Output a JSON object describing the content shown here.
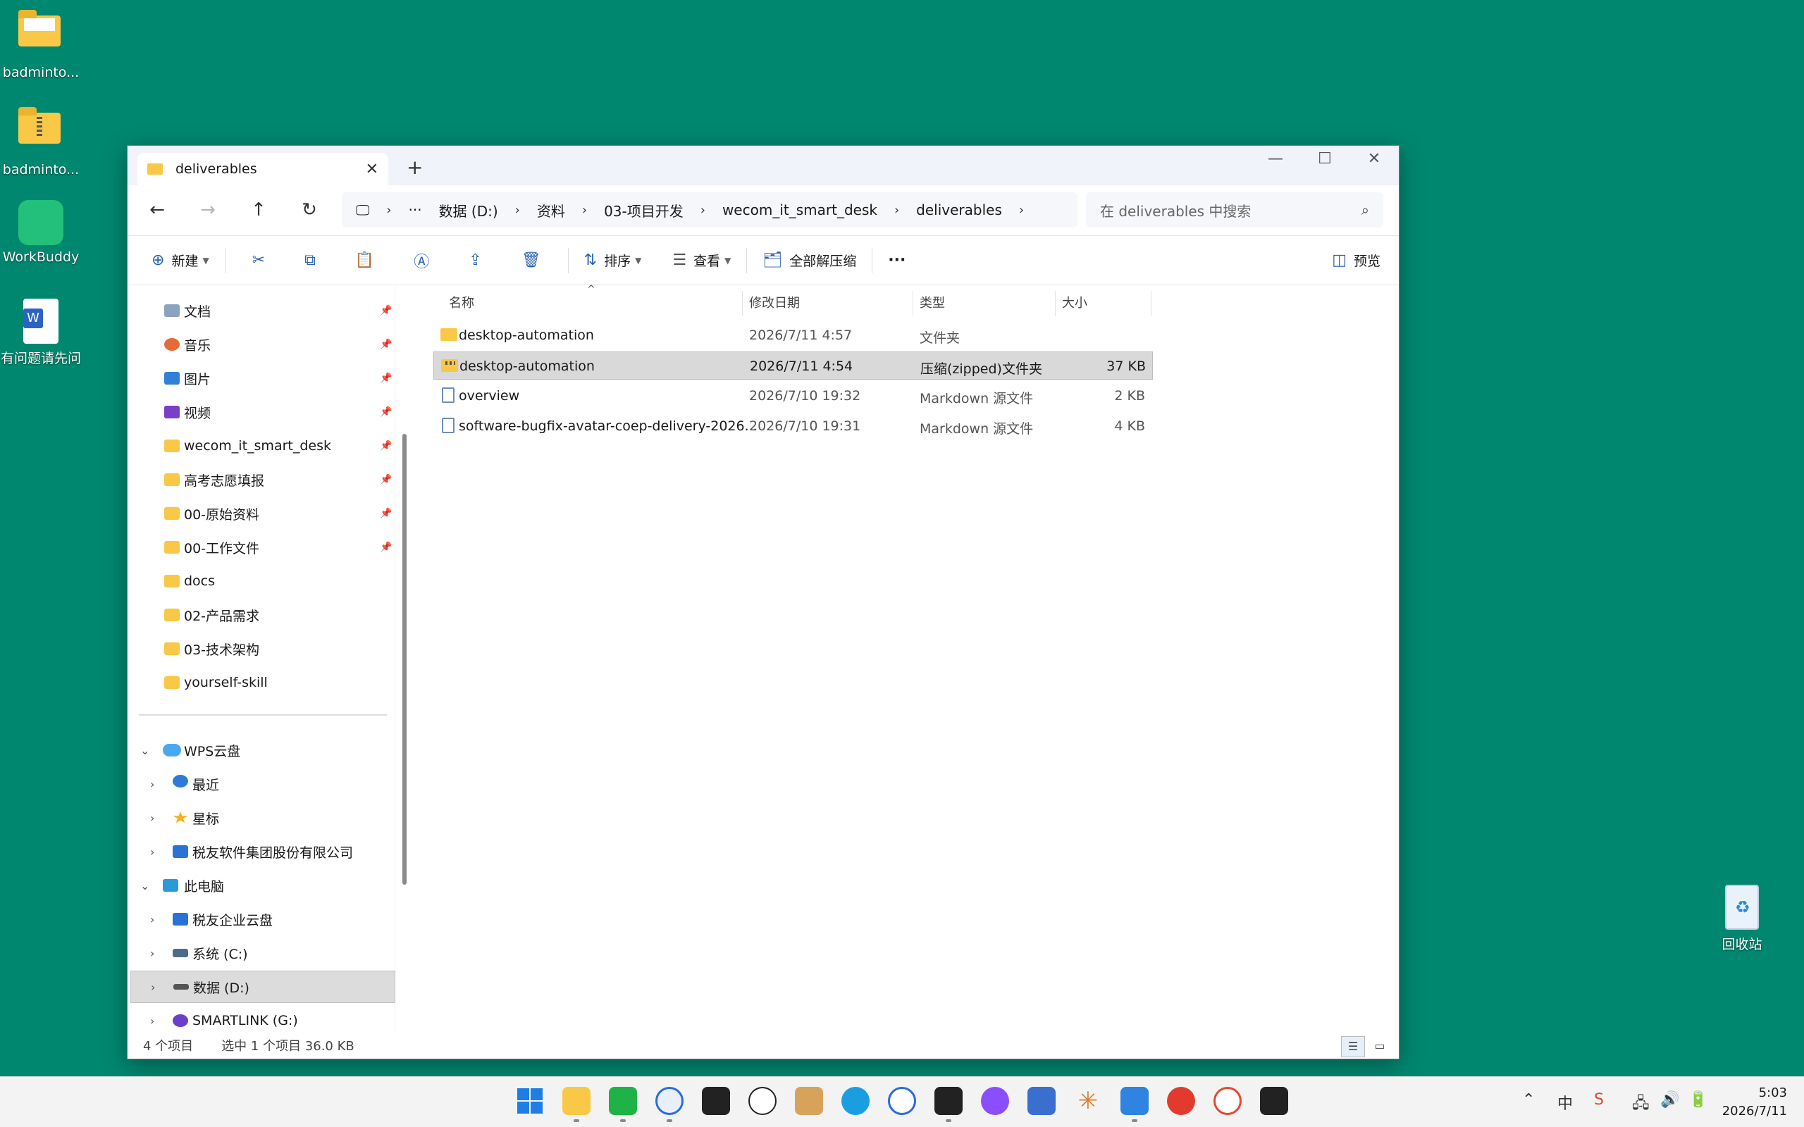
{
  "desktop": {
    "icons": [
      {
        "label": "badminto..."
      },
      {
        "label": "badminto..."
      },
      {
        "label": "WorkBuddy"
      },
      {
        "label": "有问题请先问"
      },
      {
        "label": "回收站"
      }
    ]
  },
  "window": {
    "tab_title": "deliverables",
    "tab_close": "✕",
    "new_tab": "+",
    "controls": {
      "minimize": "—",
      "maximize": "☐",
      "close": "✕"
    }
  },
  "address": {
    "crumbs": [
      "数据 (D:)",
      "资料",
      "03-项目开发",
      "wecom_it_smart_desk",
      "deliverables"
    ],
    "search_placeholder": "在 deliverables 中搜索"
  },
  "commands": {
    "new": "新建",
    "sort": "排序",
    "view": "查看",
    "extract_all": "全部解压缩",
    "more": "···",
    "preview": "预览"
  },
  "sidebar": {
    "quick_access": [
      {
        "label": "文档",
        "icon": "documents-icon",
        "pinned": true
      },
      {
        "label": "音乐",
        "icon": "music-icon",
        "pinned": true
      },
      {
        "label": "图片",
        "icon": "pictures-icon",
        "pinned": true
      },
      {
        "label": "视频",
        "icon": "videos-icon",
        "pinned": true
      },
      {
        "label": "wecom_it_smart_desk",
        "icon": "folder-icon",
        "pinned": true
      },
      {
        "label": "高考志愿填报",
        "icon": "folder-icon",
        "pinned": true
      },
      {
        "label": "00-原始资料",
        "icon": "folder-icon",
        "pinned": true
      },
      {
        "label": "00-工作文件",
        "icon": "folder-icon",
        "pinned": true
      },
      {
        "label": "docs",
        "icon": "folder-icon",
        "pinned": false
      },
      {
        "label": "02-产品需求",
        "icon": "folder-icon",
        "pinned": false
      },
      {
        "label": "03-技术架构",
        "icon": "folder-icon",
        "pinned": false
      },
      {
        "label": "yourself-skill",
        "icon": "folder-icon",
        "pinned": false
      }
    ],
    "tree": [
      {
        "label": "WPS云盘",
        "icon": "cloud-icon",
        "level": 0,
        "expanded": true
      },
      {
        "label": "最近",
        "icon": "clock-icon",
        "level": 1
      },
      {
        "label": "星标",
        "icon": "star-icon",
        "level": 1
      },
      {
        "label": "税友软件集团股份有限公司",
        "icon": "company-icon",
        "level": 1
      },
      {
        "label": "此电脑",
        "icon": "pc-icon",
        "level": 0,
        "expanded": true
      },
      {
        "label": "税友企业云盘",
        "icon": "cloud-drive-icon",
        "level": 1
      },
      {
        "label": "系统 (C:)",
        "icon": "disk-icon",
        "level": 1
      },
      {
        "label": "数据 (D:)",
        "icon": "drive-icon",
        "level": 1,
        "selected": true
      },
      {
        "label": "SMARTLINK (G:)",
        "icon": "network-drive-icon",
        "level": 1
      }
    ]
  },
  "files": {
    "columns": {
      "name": "名称",
      "modified": "修改日期",
      "type": "类型",
      "size": "大小"
    },
    "rows": [
      {
        "name": "desktop-automation",
        "modified": "2026/7/11 4:57",
        "type": "文件夹",
        "size": "",
        "icon": "folder-icon",
        "selected": false
      },
      {
        "name": "desktop-automation",
        "modified": "2026/7/11 4:54",
        "type": "压缩(zipped)文件夹",
        "size": "37 KB",
        "icon": "zip-folder-icon",
        "selected": true
      },
      {
        "name": "overview",
        "modified": "2026/7/10 19:32",
        "type": "Markdown 源文件",
        "size": "2 KB",
        "icon": "markdown-file-icon",
        "selected": false
      },
      {
        "name": "software-bugfix-avatar-coep-delivery-2026...",
        "modified": "2026/7/10 19:31",
        "type": "Markdown 源文件",
        "size": "4 KB",
        "icon": "markdown-file-icon",
        "selected": false
      }
    ]
  },
  "status": {
    "item_count": "4 个项目",
    "selection": "选中 1 个项目  36.0 KB"
  },
  "taskbar": {
    "time": "5:03",
    "date": "2026/7/11",
    "ime": "中"
  }
}
